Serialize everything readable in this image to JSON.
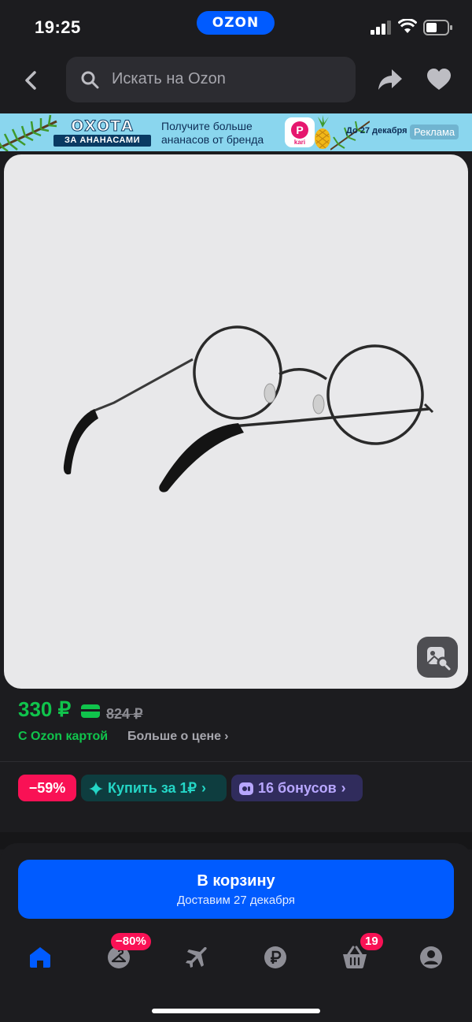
{
  "status": {
    "time": "19:25",
    "brand": "OZON"
  },
  "search": {
    "placeholder": "Искать на Ozon"
  },
  "banner": {
    "title_top": "ОХОТА",
    "title_bottom": "ЗА АНАНАСАМИ",
    "message": "Получите больше ананасов от бренда",
    "app_name": "kari",
    "date": "До 27 декабря",
    "ad_label": "Реклама"
  },
  "product": {
    "price": "330 ₽",
    "old_price": "824 ₽",
    "with_card": "С Ozon картой",
    "more_price": "Больше о цене"
  },
  "chips": {
    "discount": "−59%",
    "buy_for": "Купить за 1₽",
    "bonus": "16 бонусов"
  },
  "cart": {
    "button": "В корзину",
    "delivery": "Доставим 27 декабря"
  },
  "tabbar": {
    "fresh_badge": "−80%",
    "cart_badge": "19"
  },
  "colors": {
    "background": "#1c1c1f",
    "accent": "#005bff",
    "price_green": "#10c44c",
    "discount_pink": "#f91155"
  }
}
